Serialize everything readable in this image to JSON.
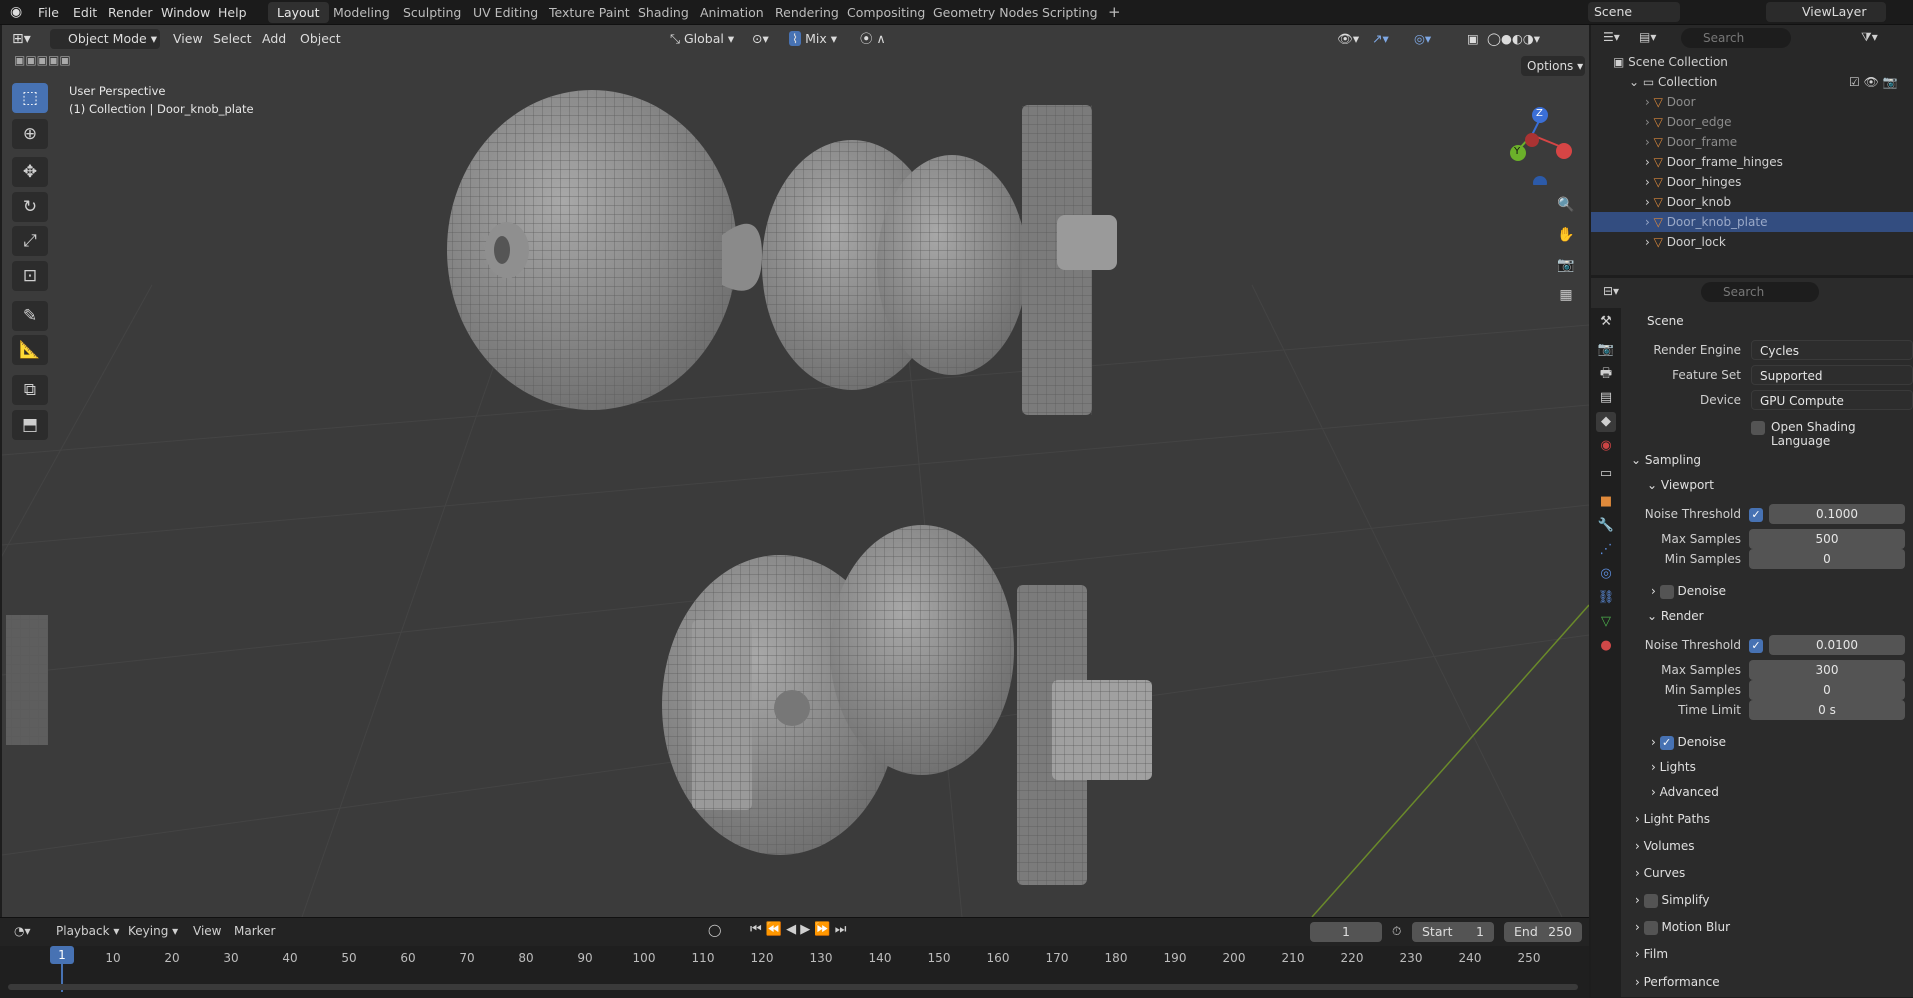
{
  "app": {
    "menus": [
      "File",
      "Edit",
      "Render",
      "Window",
      "Help"
    ],
    "workspaces": [
      "Layout",
      "Modeling",
      "Sculpting",
      "UV Editing",
      "Texture Paint",
      "Shading",
      "Animation",
      "Rendering",
      "Compositing",
      "Geometry Nodes",
      "Scripting"
    ],
    "active_workspace": "Layout",
    "add_workspace": "+",
    "scene": "Scene",
    "view_layer": "ViewLayer"
  },
  "viewport": {
    "mode": "Object Mode",
    "menus": [
      "View",
      "Select",
      "Add",
      "Object"
    ],
    "orientation": "Global",
    "snap_mix": "Mix",
    "options": "Options",
    "info_line1": "User Perspective",
    "info_line2": "(1) Collection | Door_knob_plate",
    "gizmo_y": "Y",
    "gizmo_z": "Z"
  },
  "outliner": {
    "search_placeholder": "Search",
    "root": "Scene Collection",
    "collection": "Collection",
    "items": [
      "Door",
      "Door_edge",
      "Door_frame",
      "Door_frame_hinges",
      "Door_hinges",
      "Door_knob",
      "Door_knob_plate",
      "Door_lock"
    ],
    "selected": "Door_knob_plate"
  },
  "properties": {
    "search_placeholder": "Search",
    "context": "Scene",
    "render_engine_label": "Render Engine",
    "render_engine": "Cycles",
    "feature_set_label": "Feature Set",
    "feature_set": "Supported",
    "device_label": "Device",
    "device": "GPU Compute",
    "osl_label": "Open Shading Language",
    "sampling": "Sampling",
    "viewport_sec": "Viewport",
    "vp_noise_label": "Noise Threshold",
    "vp_noise": "0.1000",
    "vp_max_label": "Max Samples",
    "vp_max": "500",
    "vp_min_label": "Min Samples",
    "vp_min": "0",
    "vp_denoise": "Denoise",
    "render_sec": "Render",
    "r_noise_label": "Noise Threshold",
    "r_noise": "0.0100",
    "r_max_label": "Max Samples",
    "r_max": "300",
    "r_min_label": "Min Samples",
    "r_min": "0",
    "r_time_label": "Time Limit",
    "r_time": "0 s",
    "r_denoise": "Denoise",
    "lights": "Lights",
    "advanced": "Advanced",
    "light_paths": "Light Paths",
    "volumes": "Volumes",
    "curves": "Curves",
    "simplify": "Simplify",
    "motion_blur": "Motion Blur",
    "film": "Film",
    "performance": "Performance"
  },
  "timeline": {
    "menus": [
      "Playback",
      "Keying",
      "View",
      "Marker"
    ],
    "current_frame": "1",
    "start_label": "Start",
    "start": "1",
    "end_label": "End",
    "end": "250",
    "ticks": [
      "1",
      "10",
      "20",
      "30",
      "40",
      "50",
      "60",
      "70",
      "80",
      "90",
      "100",
      "110",
      "120",
      "130",
      "140",
      "150",
      "160",
      "170",
      "180",
      "190",
      "200",
      "210",
      "220",
      "230",
      "240",
      "250"
    ]
  },
  "colors": {
    "accent": "#4772b3",
    "select_row": "#334d80",
    "viewport_bg": "#3b3b3b"
  }
}
